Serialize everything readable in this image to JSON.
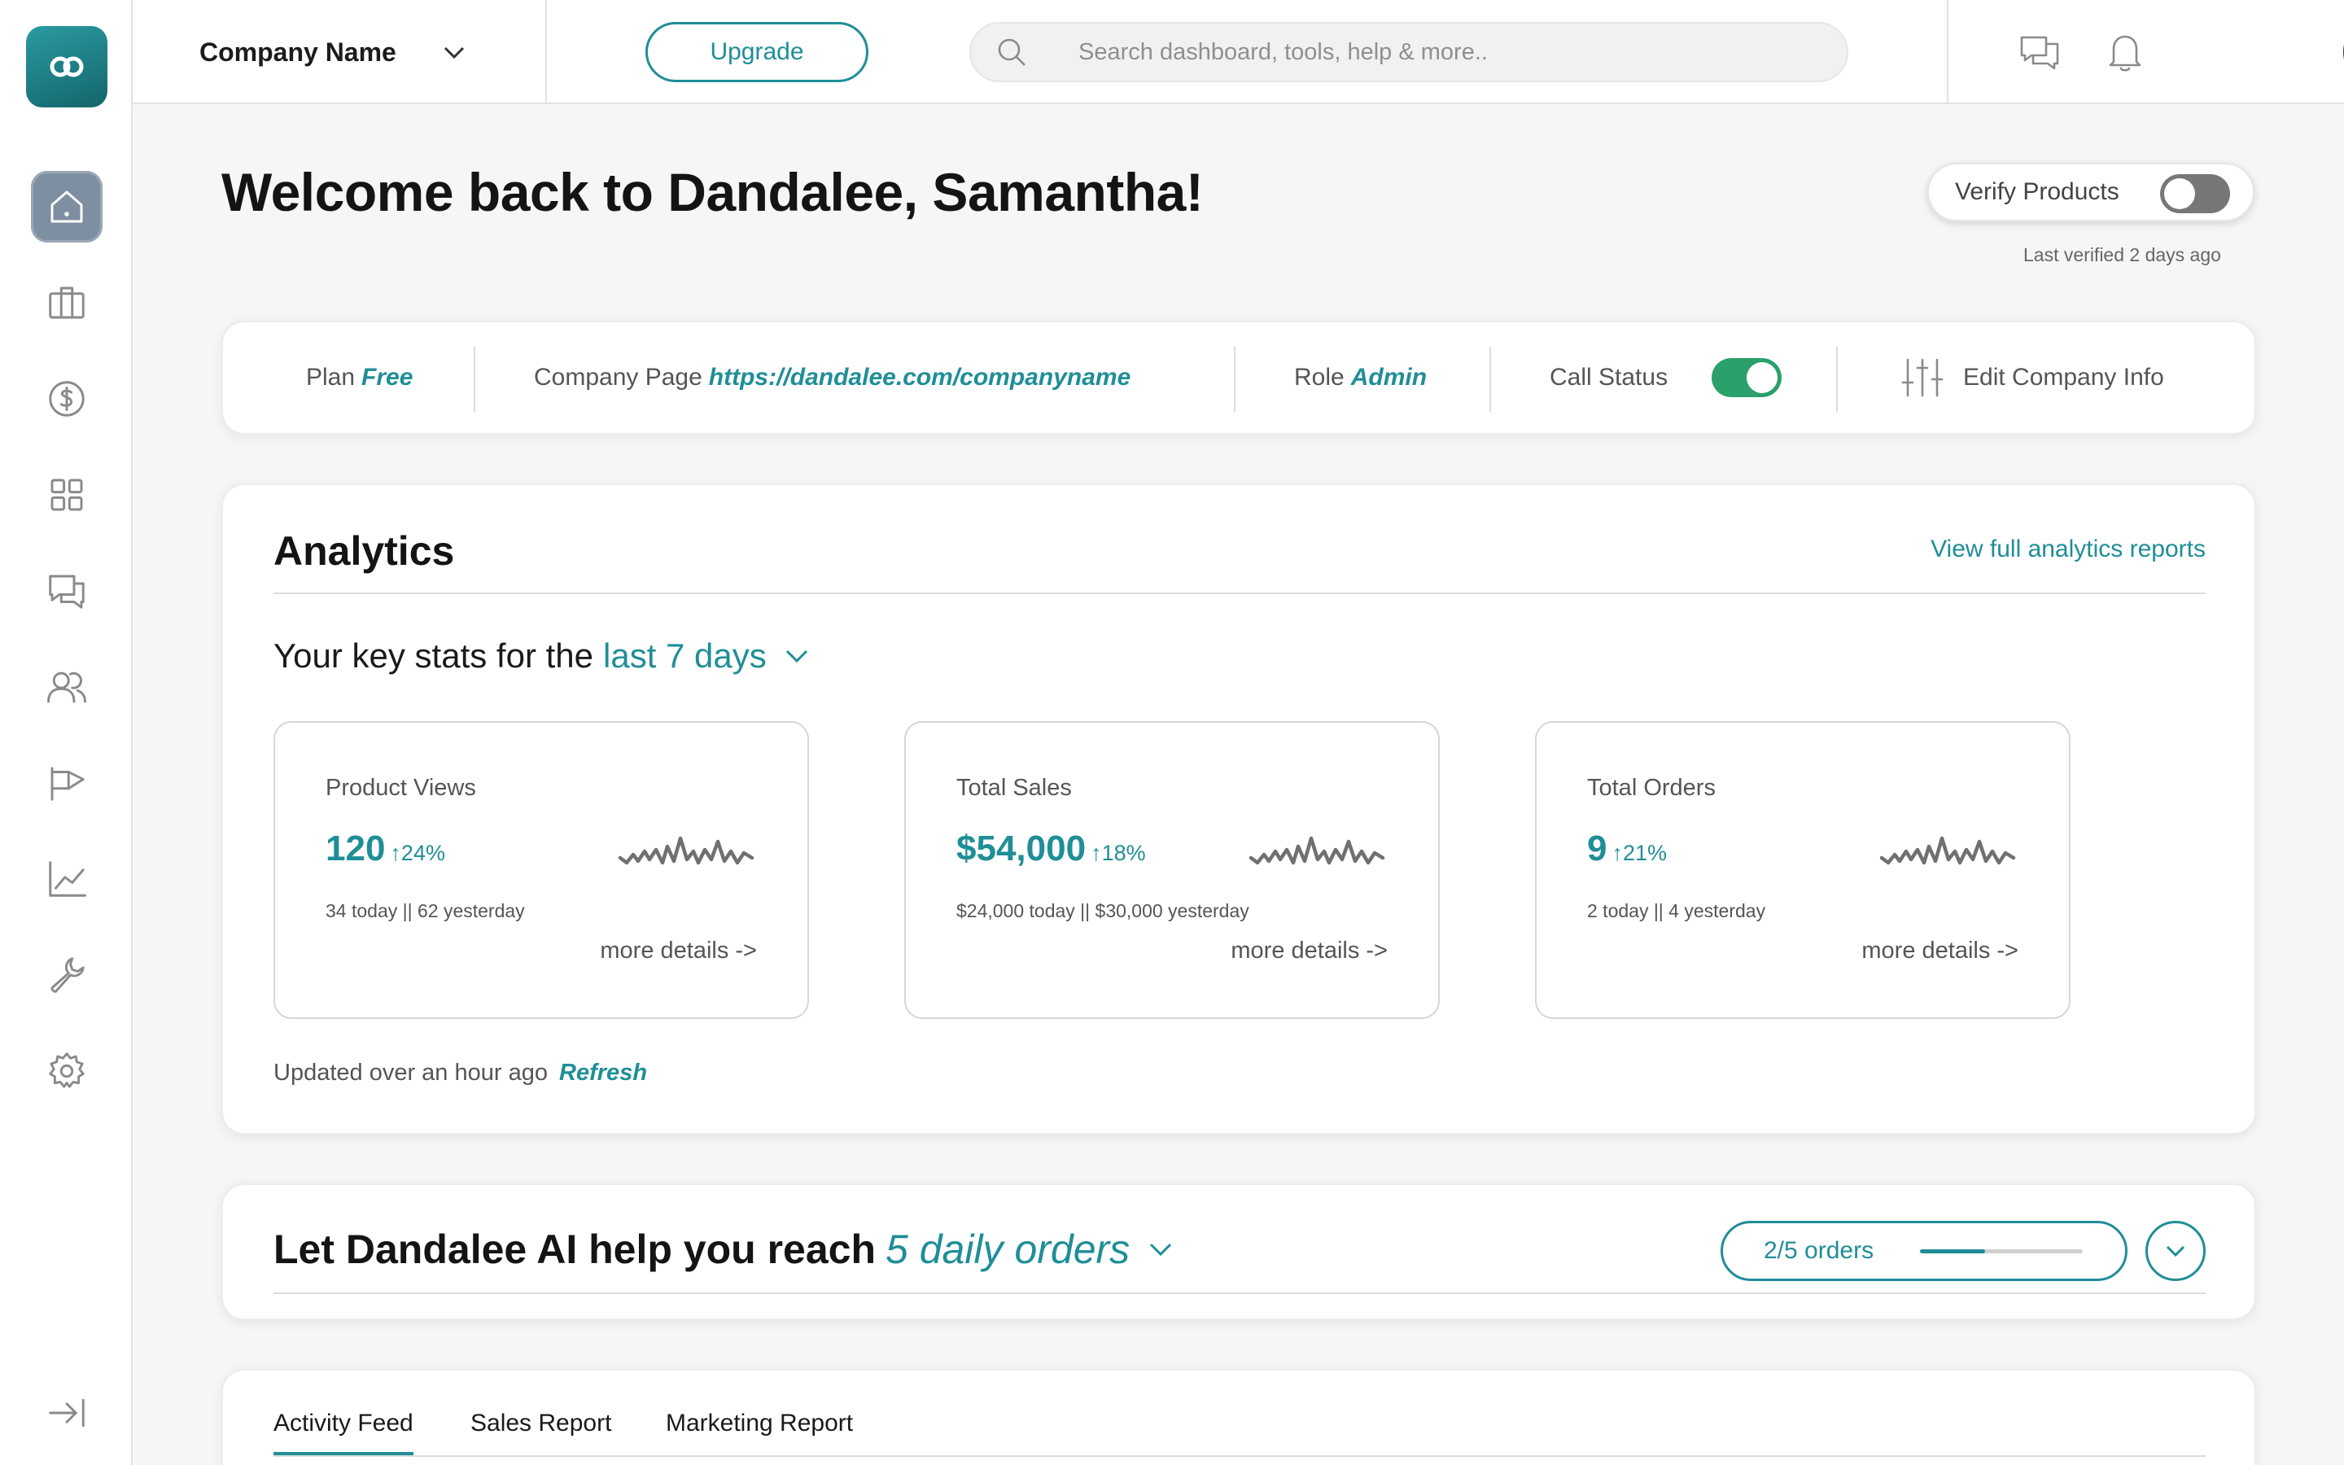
{
  "company": {
    "name": "Company Name"
  },
  "header": {
    "upgrade_label": "Upgrade",
    "search_placeholder": "Search dashboard, tools, help & more.."
  },
  "icons": {
    "logo": "logo-icon",
    "home": "home-icon",
    "briefcase": "briefcase-icon",
    "dollar": "dollar-icon",
    "grid": "grid-icon",
    "chat": "chat-icon",
    "users": "users-icon",
    "megaphone": "megaphone-icon",
    "chart": "chart-icon",
    "wrench": "wrench-icon",
    "settings": "gear-icon",
    "collapse": "collapse-sidebar-icon",
    "messages": "messages-icon",
    "bell": "bell-icon",
    "sliders": "sliders-icon",
    "search": "search-icon"
  },
  "welcome": "Welcome back to Dandalee, Samantha!",
  "verify": {
    "label": "Verify Products",
    "enabled": false,
    "last_verified": "Last verified 2 days ago"
  },
  "info": {
    "plan_label": "Plan",
    "plan_value": "Free",
    "page_label": "Company Page",
    "page_value": "https://dandalee.com/companyname",
    "role_label": "Role",
    "role_value": "Admin",
    "call_label": "Call Status",
    "call_enabled": true,
    "edit_label": "Edit Company Info"
  },
  "analytics": {
    "title": "Analytics",
    "link": "View full analytics reports",
    "keystats_prefix": "Your key stats for the",
    "period": "last 7 days",
    "stats": [
      {
        "label": "Product Views",
        "value": "120",
        "delta": "↑24%",
        "sub": "34 today  ||  62 yesterday",
        "more": "more details ->"
      },
      {
        "label": "Total Sales",
        "value": "$54,000",
        "delta": "↑18%",
        "sub": "$24,000 today  ||  $30,000 yesterday",
        "more": "more details ->"
      },
      {
        "label": "Total Orders",
        "value": "9",
        "delta": "↑21%",
        "sub": "2 today  ||  4 yesterday",
        "more": "more details ->"
      }
    ],
    "updated_text": "Updated over an hour ago",
    "refresh": "Refresh"
  },
  "ai": {
    "prefix": "Let Dandalee AI help you reach",
    "goal": "5 daily orders",
    "progress_text": "2/5 orders",
    "progress_fraction": 0.4
  },
  "tabs": [
    "Activity Feed",
    "Sales Report",
    "Marketing Report"
  ],
  "colors": {
    "accent": "#1f8e97",
    "toggle_on": "#2aa06a",
    "toggle_off": "#777777",
    "logo": "#1f7c84"
  }
}
